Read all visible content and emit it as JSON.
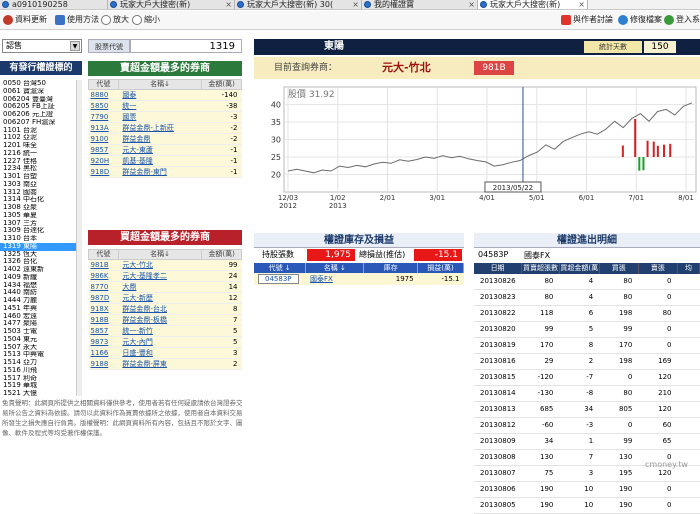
{
  "browser": {
    "tabs": [
      {
        "label": "a0910190258"
      },
      {
        "label": "玩家大戶大搜密(新)"
      },
      {
        "label": "玩家大戶大搜密(新) 30("
      },
      {
        "label": "我的權證寶"
      },
      {
        "label": "玩家大戶大搜密(新)"
      }
    ]
  },
  "toolbar": {
    "refresh": "資料更新",
    "help": "使用方法",
    "zoom_in": "放大",
    "zoom_out": "縮小",
    "forum": "與作者討論",
    "repair": "修復檔案",
    "login": "登入系統"
  },
  "left": {
    "select_value": "認售",
    "header": "有發行權證標的",
    "stocks": [
      "0050 台灣50",
      "0061 寶滬深",
      "006204 豐臺灣",
      "006205 FB上証",
      "006206 元上證",
      "006207 FH滬深",
      "1101 台泥",
      "1102 亞泥",
      "1201 味全",
      "1216 統一",
      "1227 佳格",
      "1234 黑松",
      "1301 台塑",
      "1303 南亞",
      "1312 國喬",
      "1314 中石化",
      "1308 亞聚",
      "1305 華夏",
      "1307 三芳",
      "1309 台達化",
      "1310 台苯",
      "1319 東陽",
      "1325 恆大",
      "1326 台化",
      "1402 遠東新",
      "1409 新纖",
      "1434 福懋",
      "1440 南紡",
      "1444 力麗",
      "1451 年興",
      "1460 宏遠",
      "1477 聚陽",
      "1503 士電",
      "1504 東元",
      "1507 永大",
      "1513 中興電",
      "1514 亞力",
      "1516 川飛",
      "1517 利奇",
      "1519 華城",
      "1521 大億",
      "1522 堤維西",
      "1524 耿鼎",
      "1528 恩德",
      "1532 勤美",
      "1535 中宇"
    ],
    "selected_index": 21
  },
  "middle": {
    "stock_code_label": "股票代號",
    "stock_code": "1319",
    "sell_header": "賣超金額最多的券商",
    "buy_header": "買超金額最多的券商",
    "col_code": "代號",
    "col_name": "名稱↓",
    "col_amount": "金額(萬)",
    "sell_rows": [
      {
        "code": "8880",
        "name": "國泰",
        "amount": "-140"
      },
      {
        "code": "5850",
        "name": "統一",
        "amount": "-38"
      },
      {
        "code": "7790",
        "name": "國票",
        "amount": "-3"
      },
      {
        "code": "913A",
        "name": "群益金鼎-上新莊",
        "amount": "-2"
      },
      {
        "code": "9100",
        "name": "群益金鼎",
        "amount": "-2"
      },
      {
        "code": "9857",
        "name": "元大-東蘆",
        "amount": "-1"
      },
      {
        "code": "920H",
        "name": "凱基-基隆",
        "amount": "-1"
      },
      {
        "code": "918D",
        "name": "群益金鼎-東門",
        "amount": "-1"
      }
    ],
    "buy_rows": [
      {
        "code": "981B",
        "name": "元大-竹北",
        "amount": "99"
      },
      {
        "code": "986K",
        "name": "元大-基隆孝二",
        "amount": "24"
      },
      {
        "code": "8770",
        "name": "大鼎",
        "amount": "14"
      },
      {
        "code": "987D",
        "name": "元大-新歷",
        "amount": "12"
      },
      {
        "code": "918X",
        "name": "群益金鼎-台北",
        "amount": "8"
      },
      {
        "code": "918B",
        "name": "群益金鼎-板橋",
        "amount": "7"
      },
      {
        "code": "5857",
        "name": "統一-新竹",
        "amount": "5"
      },
      {
        "code": "9873",
        "name": "元大-內門",
        "amount": "5"
      },
      {
        "code": "1166",
        "name": "日盛-豐和",
        "amount": "3"
      },
      {
        "code": "9188",
        "name": "群益金鼎-屏東",
        "amount": "2"
      }
    ],
    "disclaimer": "免責聲明：此網頁所提供之相關資料僅供參考，使用者若有任何疑慮請依台灣證券交易所公告之資料為依據。請勿以此資料作為買賣依據所之依據，使用者自本資料交易所發生之損失應自行負責。版權聲明：此網頁資料所有內容，包括且不限於文字、圖像、軟件及程式等均受著作權保護。"
  },
  "right": {
    "stock_name": "東陽",
    "days_label": "統計天數",
    "days_value": "150",
    "query_label": "目前查詢券商：",
    "broker_name": "元大-竹北",
    "broker_code": "981B",
    "chart_price_label": "股價 31.92",
    "chart_tooltip": "2013/05/22",
    "holdings_header": "權證庫存及損益",
    "holdings_count_label": "持股張數",
    "holdings_count": "1,975",
    "pnl_label": "總損益(推估)",
    "pnl_value": "-15.1",
    "hold_cols": [
      "代號 ↓",
      "名稱 ↓",
      "庫存",
      "損益(萬)"
    ],
    "hold_rows": [
      {
        "code": "04583P",
        "name": "國泰FX",
        "qty": "1975",
        "pnl": "-15.1"
      }
    ],
    "detail_header": "權證進出明細",
    "detail_code": "04583P",
    "detail_name": "國泰FX",
    "detail_cols": [
      "日期",
      "買賣超張數",
      "買超金額(萬",
      "買張",
      "賣張",
      "均"
    ],
    "detail_rows": [
      {
        "date": "20130826",
        "net": "80",
        "amt": "4",
        "buy": "80",
        "sell": "0"
      },
      {
        "date": "20130823",
        "net": "80",
        "amt": "4",
        "buy": "80",
        "sell": "0"
      },
      {
        "date": "20130822",
        "net": "118",
        "amt": "6",
        "buy": "198",
        "sell": "80"
      },
      {
        "date": "20130820",
        "net": "99",
        "amt": "5",
        "buy": "99",
        "sell": "0"
      },
      {
        "date": "20130819",
        "net": "170",
        "amt": "8",
        "buy": "170",
        "sell": "0"
      },
      {
        "date": "20130816",
        "net": "29",
        "amt": "2",
        "buy": "198",
        "sell": "169"
      },
      {
        "date": "20130815",
        "net": "-120",
        "amt": "-7",
        "buy": "0",
        "sell": "120"
      },
      {
        "date": "20130814",
        "net": "-130",
        "amt": "-8",
        "buy": "80",
        "sell": "210"
      },
      {
        "date": "20130813",
        "net": "685",
        "amt": "34",
        "buy": "805",
        "sell": "120"
      },
      {
        "date": "20130812",
        "net": "-60",
        "amt": "-3",
        "buy": "0",
        "sell": "60"
      },
      {
        "date": "20130809",
        "net": "34",
        "amt": "1",
        "buy": "99",
        "sell": "65"
      },
      {
        "date": "20130808",
        "net": "130",
        "amt": "7",
        "buy": "130",
        "sell": "0"
      },
      {
        "date": "20130807",
        "net": "75",
        "amt": "3",
        "buy": "195",
        "sell": "120"
      },
      {
        "date": "20130806",
        "net": "190",
        "amt": "10",
        "buy": "190",
        "sell": "0"
      },
      {
        "date": "20130805",
        "net": "190",
        "amt": "10",
        "buy": "190",
        "sell": "0"
      }
    ]
  },
  "watermark": "cmoney.tw",
  "colors": {
    "navy": "#1b3a6b",
    "green_header": "#2b7a3b",
    "red_header": "#b8202a",
    "chart_line": "#6b6b6b",
    "bar_green": "#17a02a",
    "bar_red": "#d42020"
  },
  "chart_data": {
    "type": "line",
    "title": "",
    "series_label": "股價 31.92",
    "x_ticks": [
      "12/03 2012",
      "1/02 2013",
      "2/01",
      "3/01",
      "4/01",
      "5/01",
      "6/01",
      "7/01",
      "8/01"
    ],
    "ylim": [
      15,
      45
    ],
    "y_ticks": [
      20,
      25,
      30,
      35,
      40
    ],
    "price": [
      21,
      21.5,
      21,
      20.5,
      21.3,
      21,
      22.4,
      22,
      22.6,
      22.2,
      23,
      23.5,
      23.2,
      24.2,
      23.8,
      24.3,
      25,
      24.6,
      25.4,
      24.8,
      25.2,
      24.5,
      24,
      23.6,
      22.4,
      22.8,
      23.5,
      24,
      25.4,
      26.4,
      28.5,
      27.2,
      29.4,
      30.5,
      31.5,
      32.2,
      31.5,
      33,
      35.2,
      33.4,
      36,
      37.4,
      35.2,
      38,
      38.6,
      37,
      39.5,
      40.5
    ],
    "net_buy_markers": [
      {
        "pos": 0.82,
        "net": 80
      },
      {
        "pos": 0.85,
        "net": 685
      },
      {
        "pos": 0.86,
        "net": -130
      },
      {
        "pos": 0.87,
        "net": -120
      },
      {
        "pos": 0.88,
        "net": 190
      },
      {
        "pos": 0.895,
        "net": 170
      },
      {
        "pos": 0.905,
        "net": 75
      },
      {
        "pos": 0.92,
        "net": 99
      },
      {
        "pos": 0.935,
        "net": 118
      }
    ],
    "marker_date_pos": 0.58
  }
}
